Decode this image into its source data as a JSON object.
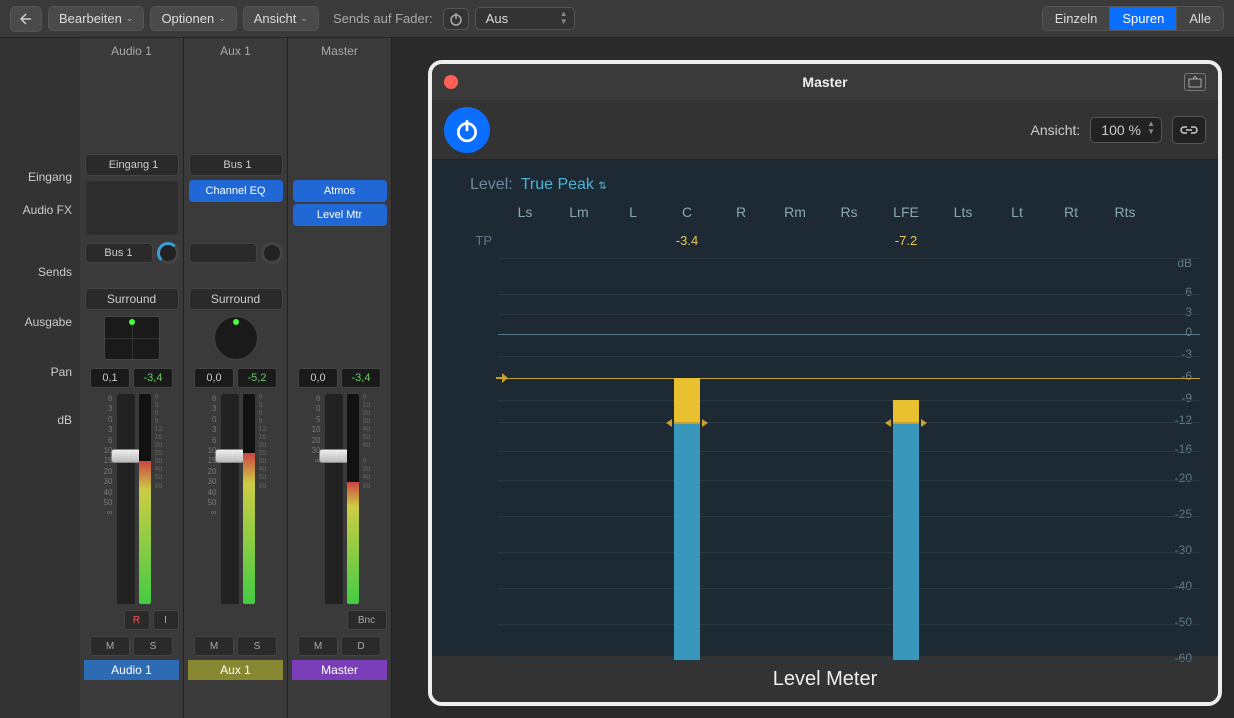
{
  "toolbar": {
    "edit": "Bearbeiten",
    "options": "Optionen",
    "view": "Ansicht",
    "sends_label": "Sends auf Fader:",
    "sends_value": "Aus",
    "view_single": "Einzeln",
    "view_tracks": "Spuren",
    "view_all": "Alle"
  },
  "row_labels": {
    "input": "Eingang",
    "fx": "Audio FX",
    "sends": "Sends",
    "output": "Ausgabe",
    "pan": "Pan",
    "db": "dB"
  },
  "strips": [
    {
      "title": "Audio 1",
      "input": "Eingang 1",
      "fx": [],
      "sends": [
        "Bus 1"
      ],
      "output": "Surround",
      "pan_type": "grid",
      "db_val": "0,1",
      "db_peak": "-3,4",
      "buttons_top": [
        "R",
        "I"
      ],
      "ms": [
        "M",
        "S"
      ],
      "name": "Audio 1",
      "color": "blue",
      "meter_h": 68,
      "fader_y": 55
    },
    {
      "title": "Aux 1",
      "input": "Bus 1",
      "fx": [
        "Channel EQ"
      ],
      "sends": [
        ""
      ],
      "output": "Surround",
      "pan_type": "circle",
      "db_val": "0,0",
      "db_peak": "-5,2",
      "buttons_top": [],
      "ms": [
        "M",
        "S"
      ],
      "name": "Aux 1",
      "color": "olive",
      "meter_h": 72,
      "fader_y": 55
    },
    {
      "title": "Master",
      "input": null,
      "fx": [
        "Atmos",
        "Level Mtr"
      ],
      "sends": null,
      "output": null,
      "pan_type": null,
      "db_val": "0,0",
      "db_peak": "-3,4",
      "buttons_top": [
        "Bnc"
      ],
      "ms": [
        "M",
        "D"
      ],
      "name": "Master",
      "color": "purple",
      "meter_h": 58,
      "fader_y": 55
    }
  ],
  "plugin": {
    "title": "Master",
    "ansicht_label": "Ansicht:",
    "zoom": "100 %",
    "level_label": "Level:",
    "level_value": "True Peak",
    "channels": [
      "Ls",
      "Lm",
      "L",
      "C",
      "R",
      "Rm",
      "Rs",
      "LFE",
      "Lts",
      "Lt",
      "Rt",
      "Rts"
    ],
    "tp_label": "TP",
    "tp_values": {
      "C": "-3.4",
      "LFE": "-7.2"
    },
    "db_label": "dB",
    "y_ticks": [
      6,
      3,
      0,
      -3,
      -6,
      -9,
      -12,
      -16,
      -20,
      -25,
      -30,
      -40,
      -50,
      -60
    ],
    "footer": "Level Meter"
  }
}
